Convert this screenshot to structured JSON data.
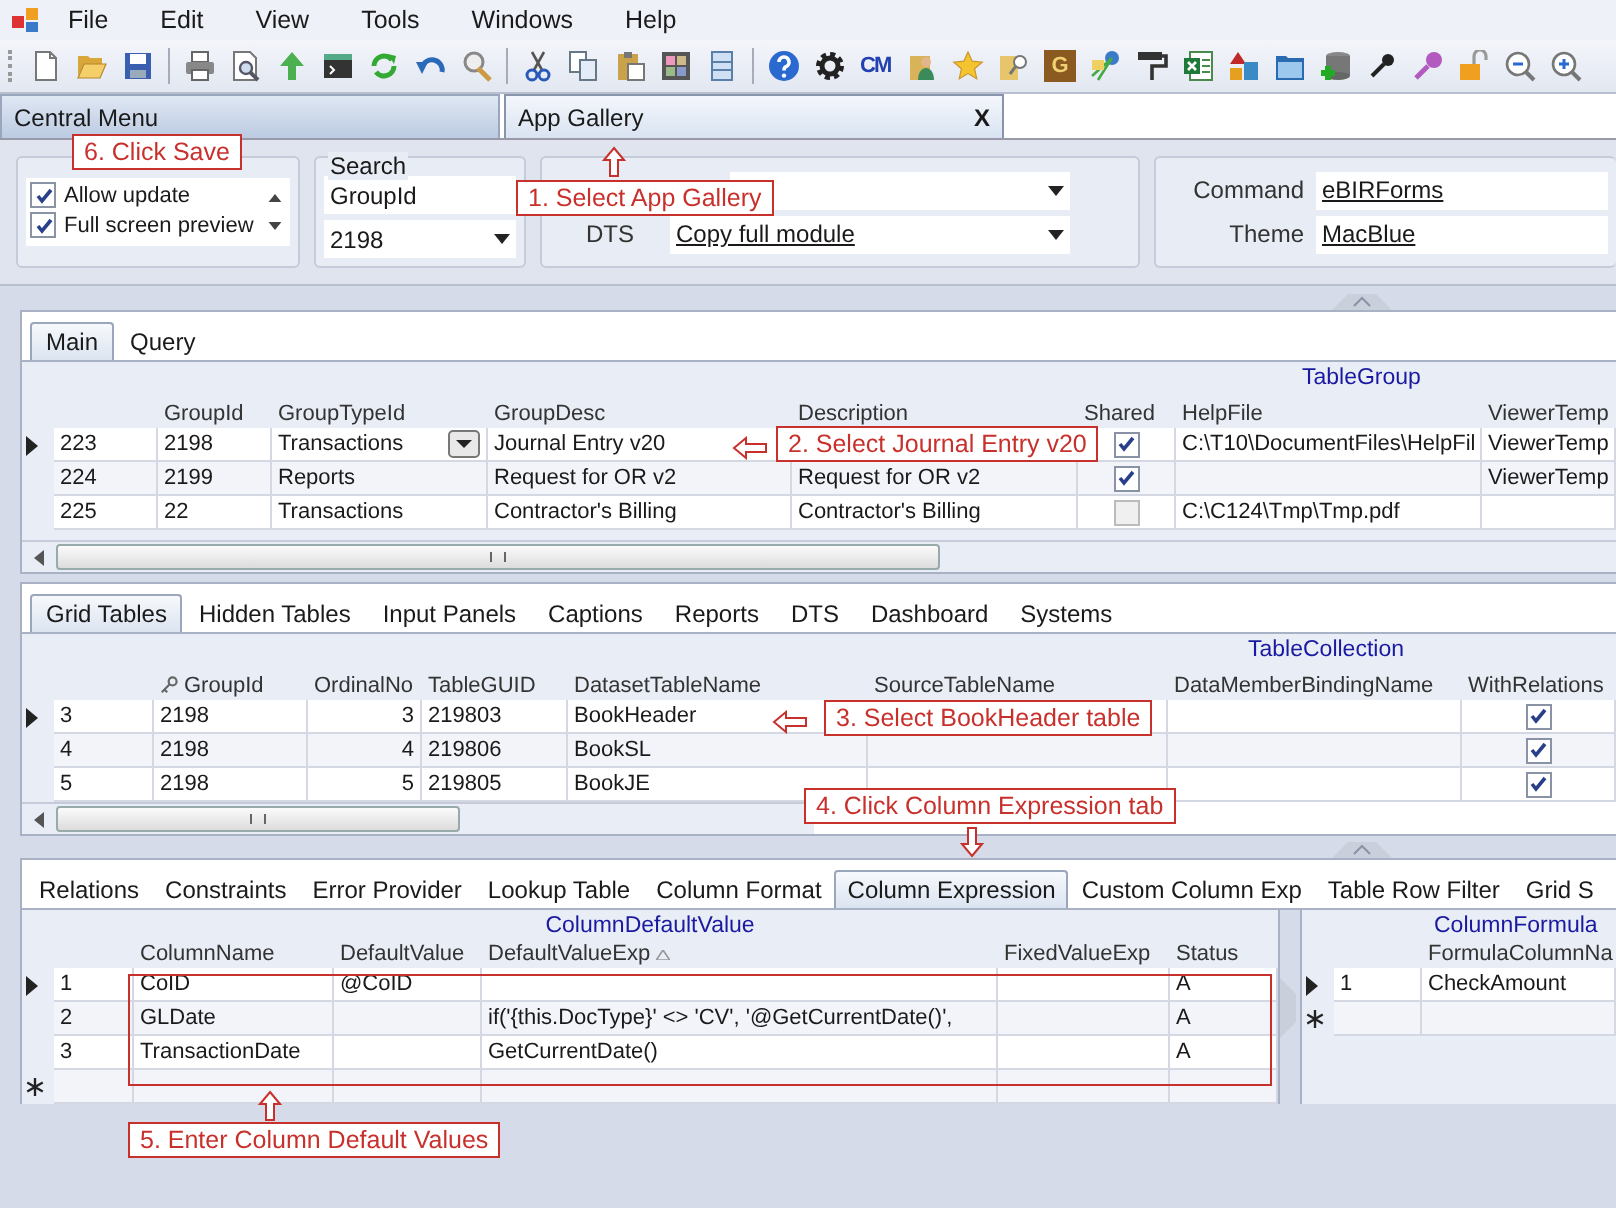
{
  "menu": [
    "File",
    "Edit",
    "View",
    "Tools",
    "Windows",
    "Help"
  ],
  "toolbar": {
    "cm_logo": "CM",
    "g_logo": "G"
  },
  "document_tabs": [
    {
      "label": "Central Menu",
      "selected": false
    },
    {
      "label": "App Gallery",
      "selected": true,
      "close": "X"
    }
  ],
  "options": {
    "checklist": [
      {
        "label": "Allow update",
        "checked": true
      },
      {
        "label": "Full screen preview",
        "checked": true
      }
    ],
    "search": {
      "title": "Search",
      "field": "GroupId",
      "combo": "2198"
    },
    "dts": {
      "label": "DTS",
      "value": "Copy full module"
    },
    "command": {
      "label": "Command",
      "value": "eBIRForms"
    },
    "theme": {
      "label": "Theme",
      "value": "MacBlue"
    }
  },
  "panels": [
    {
      "tabs": [
        {
          "label": "Main",
          "selected": true
        },
        {
          "label": "Query",
          "selected": false
        }
      ],
      "grids": [
        {
          "caption": "TableGroup",
          "columns": [
            {
              "label": "GroupId",
              "kind": "text"
            },
            {
              "label": "GroupTypeId",
              "kind": "combo"
            },
            {
              "label": "GroupDesc",
              "kind": "text"
            },
            {
              "label": "Description",
              "kind": "text"
            },
            {
              "label": "Shared",
              "kind": "check"
            },
            {
              "label": "HelpFile",
              "kind": "text"
            },
            {
              "label": "ViewerTemp",
              "kind": "text"
            }
          ],
          "rows": [
            {
              "kind": "data",
              "current": true,
              "number": "223",
              "cells": [
                "2198",
                "Transactions",
                "Journal Entry v20",
                null,
                true,
                "C:\\T10\\DocumentFiles\\HelpFil",
                "ViewerTemp"
              ]
            },
            {
              "kind": "data",
              "current": false,
              "number": "224",
              "cells": [
                "2199",
                "Reports",
                "Request for OR v2",
                "Request for OR v2",
                true,
                null,
                "ViewerTemp"
              ]
            },
            {
              "kind": "data",
              "current": false,
              "number": "225",
              "cells": [
                "22",
                "Transactions",
                "Contractor's Billing",
                "Contractor's Billing",
                false,
                "C:\\C124\\Tmp\\Tmp.pdf",
                null
              ]
            }
          ]
        }
      ]
    },
    {
      "tabs": [
        {
          "label": "Grid Tables",
          "selected": true
        },
        {
          "label": "Hidden Tables",
          "selected": false
        },
        {
          "label": "Input Panels",
          "selected": false
        },
        {
          "label": "Captions",
          "selected": false
        },
        {
          "label": "Reports",
          "selected": false
        },
        {
          "label": "DTS",
          "selected": false
        },
        {
          "label": "Dashboard",
          "selected": false
        },
        {
          "label": "Systems",
          "selected": false
        }
      ],
      "grids": [
        {
          "caption": "TableCollection",
          "columns": [
            {
              "label": "GroupId",
              "kind": "text",
              "key": true
            },
            {
              "label": "OrdinalNo",
              "kind": "number"
            },
            {
              "label": "TableGUID",
              "kind": "text"
            },
            {
              "label": "DatasetTableName",
              "kind": "text"
            },
            {
              "label": "SourceTableName",
              "kind": "text"
            },
            {
              "label": "DataMemberBindingName",
              "kind": "text"
            },
            {
              "label": "WithRelations",
              "kind": "check"
            }
          ],
          "rows": [
            {
              "kind": "data",
              "current": true,
              "number": "3",
              "cells": [
                "2198",
                "3",
                "219803",
                "BookHeader",
                null,
                null,
                true
              ]
            },
            {
              "kind": "data",
              "current": false,
              "number": "4",
              "cells": [
                "2198",
                "4",
                "219806",
                "BookSL",
                null,
                null,
                true
              ]
            },
            {
              "kind": "data",
              "current": false,
              "number": "5",
              "cells": [
                "2198",
                "5",
                "219805",
                "BookJE",
                null,
                null,
                true
              ]
            }
          ]
        }
      ]
    },
    {
      "tabs": [
        {
          "label": "Relations",
          "selected": false
        },
        {
          "label": "Constraints",
          "selected": false
        },
        {
          "label": "Error Provider",
          "selected": false
        },
        {
          "label": "Lookup Table",
          "selected": false
        },
        {
          "label": "Column Format",
          "selected": false
        },
        {
          "label": "Column Expression",
          "selected": true
        },
        {
          "label": "Custom Column Exp",
          "selected": false
        },
        {
          "label": "Table Row Filter",
          "selected": false
        },
        {
          "label": "Grid S",
          "selected": false
        }
      ],
      "grids": [
        {
          "caption": "ColumnDefaultValue",
          "columns": [
            {
              "label": "ColumnName",
              "kind": "text"
            },
            {
              "label": "DefaultValue",
              "kind": "text"
            },
            {
              "label": "DefaultValueExp",
              "kind": "text",
              "sorted": true
            },
            {
              "label": "FixedValueExp",
              "kind": "text"
            },
            {
              "label": "Status",
              "kind": "text"
            }
          ],
          "rows": [
            {
              "kind": "data",
              "current": true,
              "number": "1",
              "cells": [
                "CoID",
                "@CoID",
                null,
                null,
                "A"
              ]
            },
            {
              "kind": "data",
              "current": false,
              "number": "2",
              "cells": [
                "GLDate",
                null,
                "if('{this.DocType}' <> 'CV', '@GetCurrentDate()',",
                null,
                "A"
              ]
            },
            {
              "kind": "data",
              "current": false,
              "number": "3",
              "cells": [
                "TransactionDate",
                null,
                "GetCurrentDate()",
                null,
                "A"
              ]
            },
            {
              "kind": "new"
            }
          ]
        },
        {
          "caption": "ColumnFormula",
          "columns": [
            {
              "label": "FormulaColumnNa",
              "kind": "text"
            }
          ],
          "rows": [
            {
              "kind": "data",
              "current": true,
              "number": "1",
              "cells": [
                "CheckAmount"
              ]
            },
            {
              "kind": "new"
            }
          ]
        }
      ]
    }
  ],
  "annotations": [
    {
      "text": "6. Click Save",
      "kind": "plain"
    },
    {
      "text": "1. Select App Gallery",
      "kind": "up"
    },
    {
      "text": "2. Select Journal Entry v20",
      "kind": "left"
    },
    {
      "text": "3. Select BookHeader table",
      "kind": "left"
    },
    {
      "text": "4. Click Column Expression tab",
      "kind": "down"
    },
    {
      "text": "5. Enter Column Default Values",
      "kind": "up",
      "frame": true
    }
  ]
}
